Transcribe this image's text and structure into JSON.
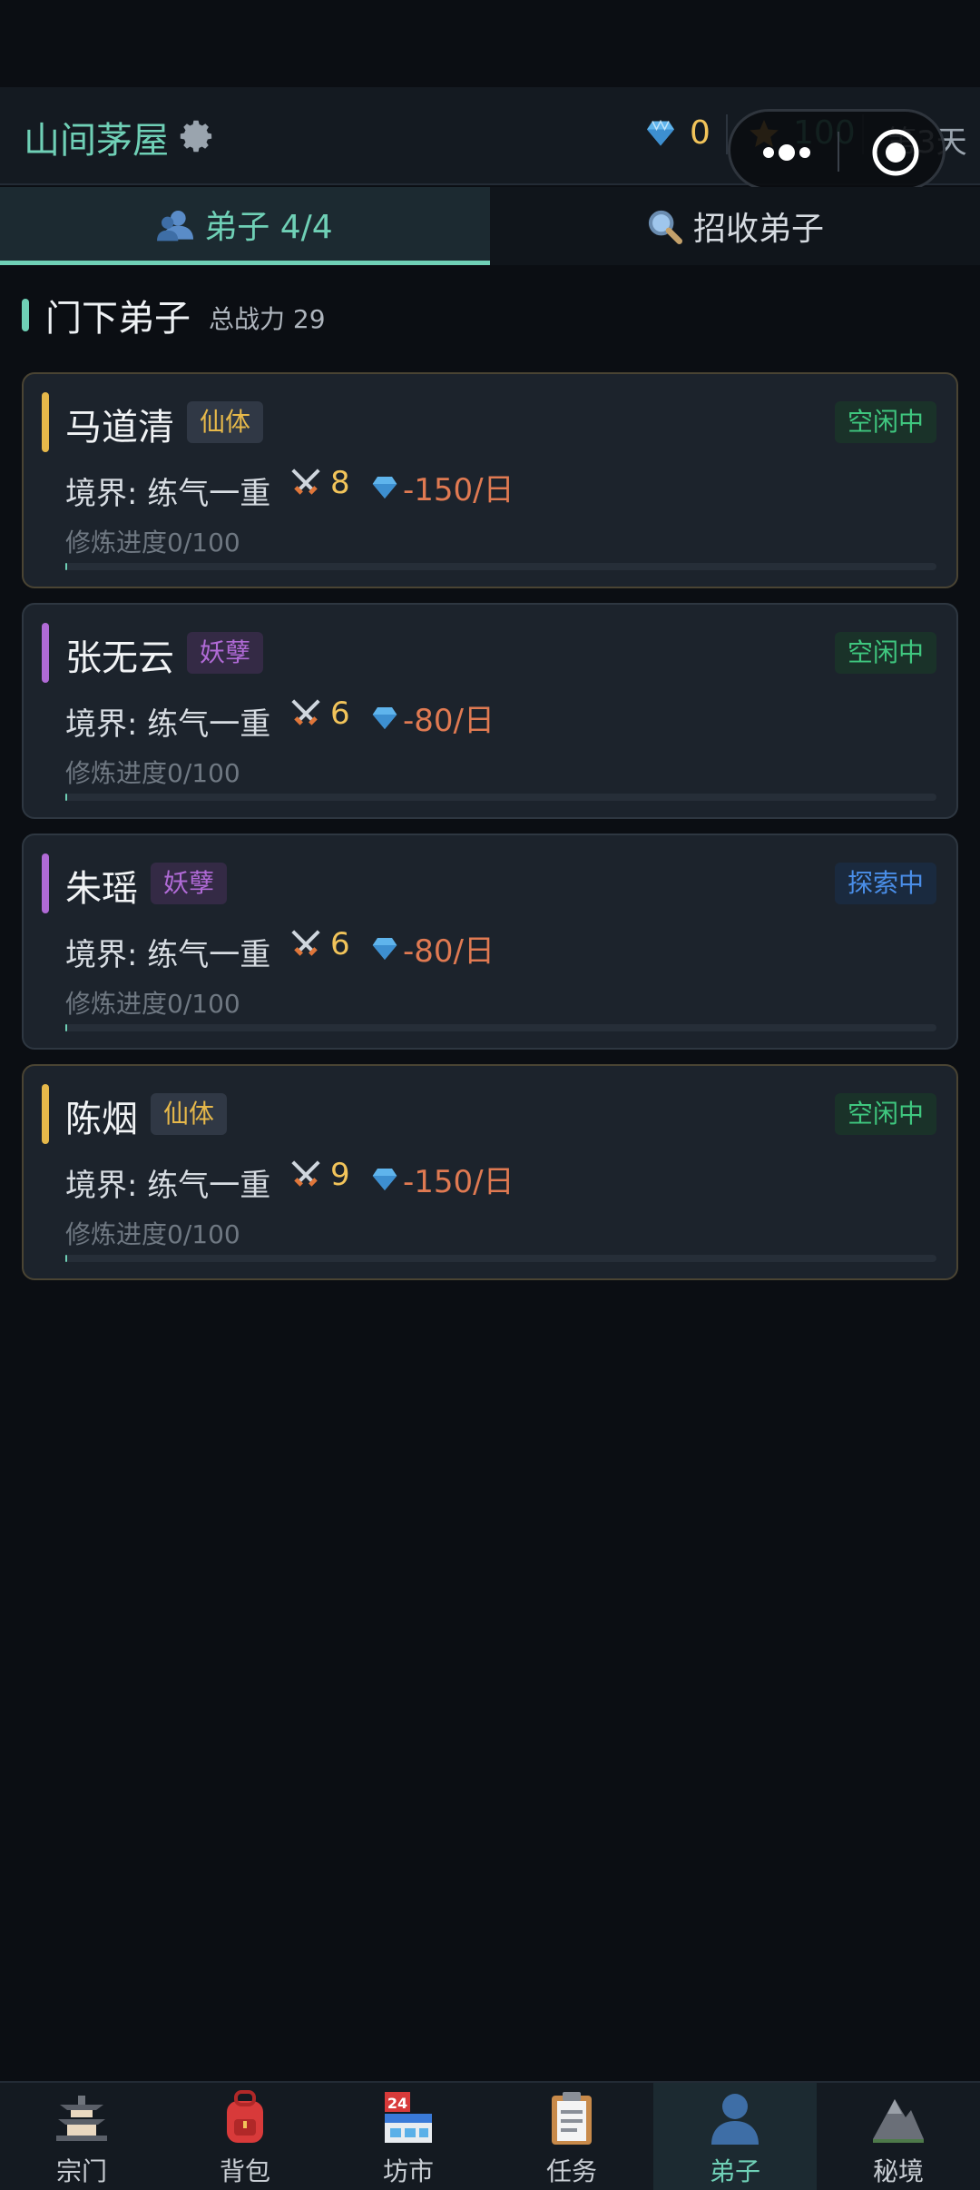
{
  "header": {
    "sect_name": "山间茅屋",
    "gems": "0",
    "reputation": "100",
    "day": "第3天"
  },
  "tabs": [
    {
      "label": "弟子 4/4",
      "icon": "disciples-icon",
      "active": true
    },
    {
      "label": "招收弟子",
      "icon": "magnifier-icon",
      "active": false
    }
  ],
  "section": {
    "title": "门下弟子",
    "subtitle": "总战力 29"
  },
  "disciples": [
    {
      "name": "马道清",
      "trait": "仙体",
      "trait_color": "#e6b84a",
      "status": "空闲中",
      "realm": "境界: 练气一重",
      "power": "8",
      "cost": "-150/日",
      "progress_label": "修炼进度0/100",
      "progress": 0
    },
    {
      "name": "张无云",
      "trait": "妖孽",
      "trait_color": "#b06ad6",
      "status": "空闲中",
      "realm": "境界: 练气一重",
      "power": "6",
      "cost": "-80/日",
      "progress_label": "修炼进度0/100",
      "progress": 0
    },
    {
      "name": "朱瑶",
      "trait": "妖孽",
      "trait_color": "#b06ad6",
      "status": "探索中",
      "realm": "境界: 练气一重",
      "power": "6",
      "cost": "-80/日",
      "progress_label": "修炼进度0/100",
      "progress": 0
    },
    {
      "name": "陈烟",
      "trait": "仙体",
      "trait_color": "#e6b84a",
      "status": "空闲中",
      "realm": "境界: 练气一重",
      "power": "9",
      "cost": "-150/日",
      "progress_label": "修炼进度0/100",
      "progress": 0
    }
  ],
  "nav": [
    {
      "label": "宗门",
      "icon": "pagoda-icon"
    },
    {
      "label": "背包",
      "icon": "backpack-icon"
    },
    {
      "label": "坊市",
      "icon": "shop-icon"
    },
    {
      "label": "任务",
      "icon": "clipboard-icon"
    },
    {
      "label": "弟子",
      "icon": "person-icon",
      "active": true
    },
    {
      "label": "秘境",
      "icon": "mountain-icon"
    }
  ],
  "colors": {
    "accent": "#6fd0b6",
    "gold": "#f2c45a",
    "cost": "#e07a52",
    "idle": "#3fc77f",
    "explore": "#4a8ee8"
  }
}
